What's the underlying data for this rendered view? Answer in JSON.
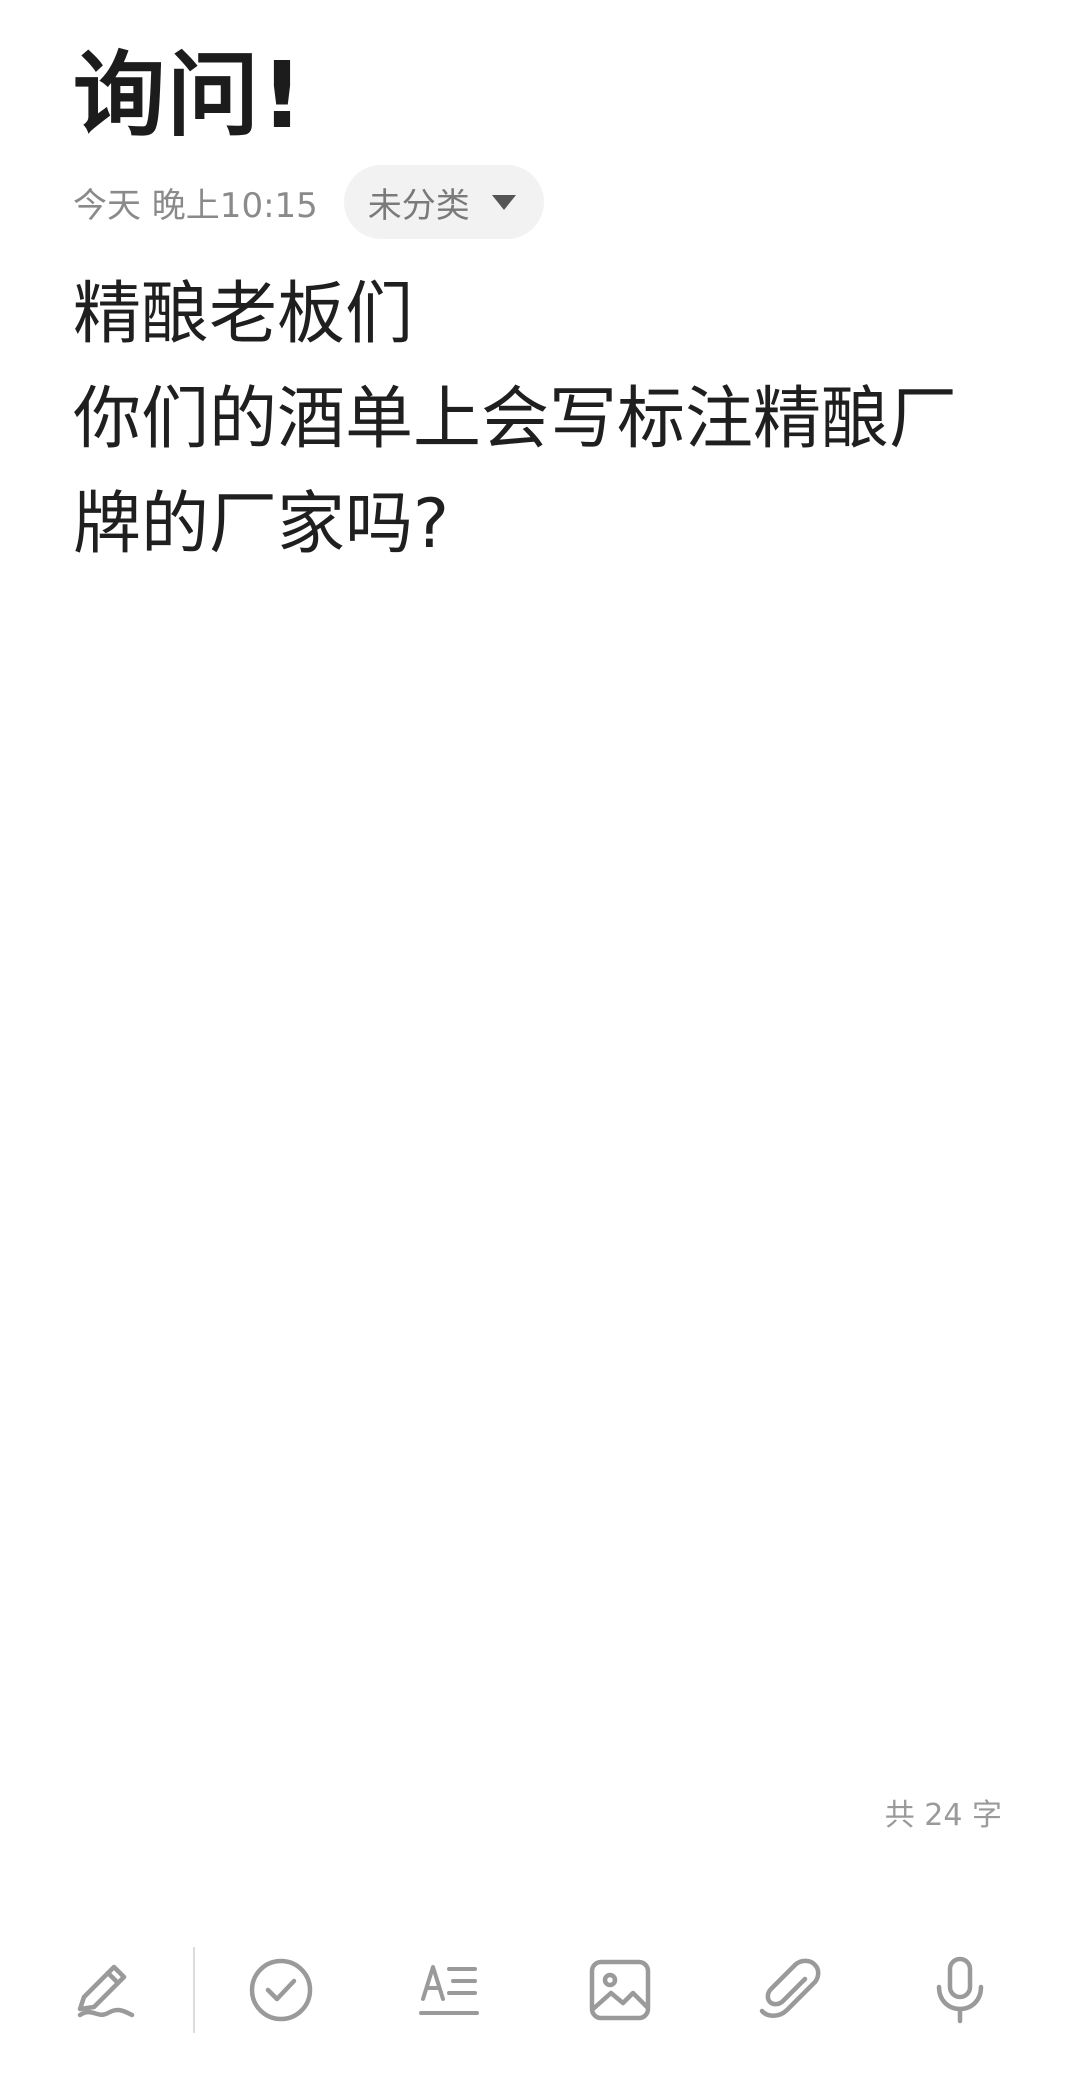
{
  "note": {
    "title": "询问!",
    "timestamp": "今天 晚上10:15",
    "category": "未分类",
    "body_lines": [
      "精酿老板们",
      "你们的酒单上会写标注精酿厂",
      "牌的厂家吗?"
    ],
    "word_count": "共 24 字"
  },
  "toolbar": {
    "icons": [
      "handwriting-pen-icon",
      "checklist-icon",
      "text-format-icon",
      "image-icon",
      "attachment-icon",
      "microphone-icon"
    ]
  },
  "colors": {
    "text_primary": "#1f1f1f",
    "text_secondary": "#8a8a8a",
    "chip_background": "#f2f2f2",
    "icon_gray": "#9a9a9a"
  }
}
